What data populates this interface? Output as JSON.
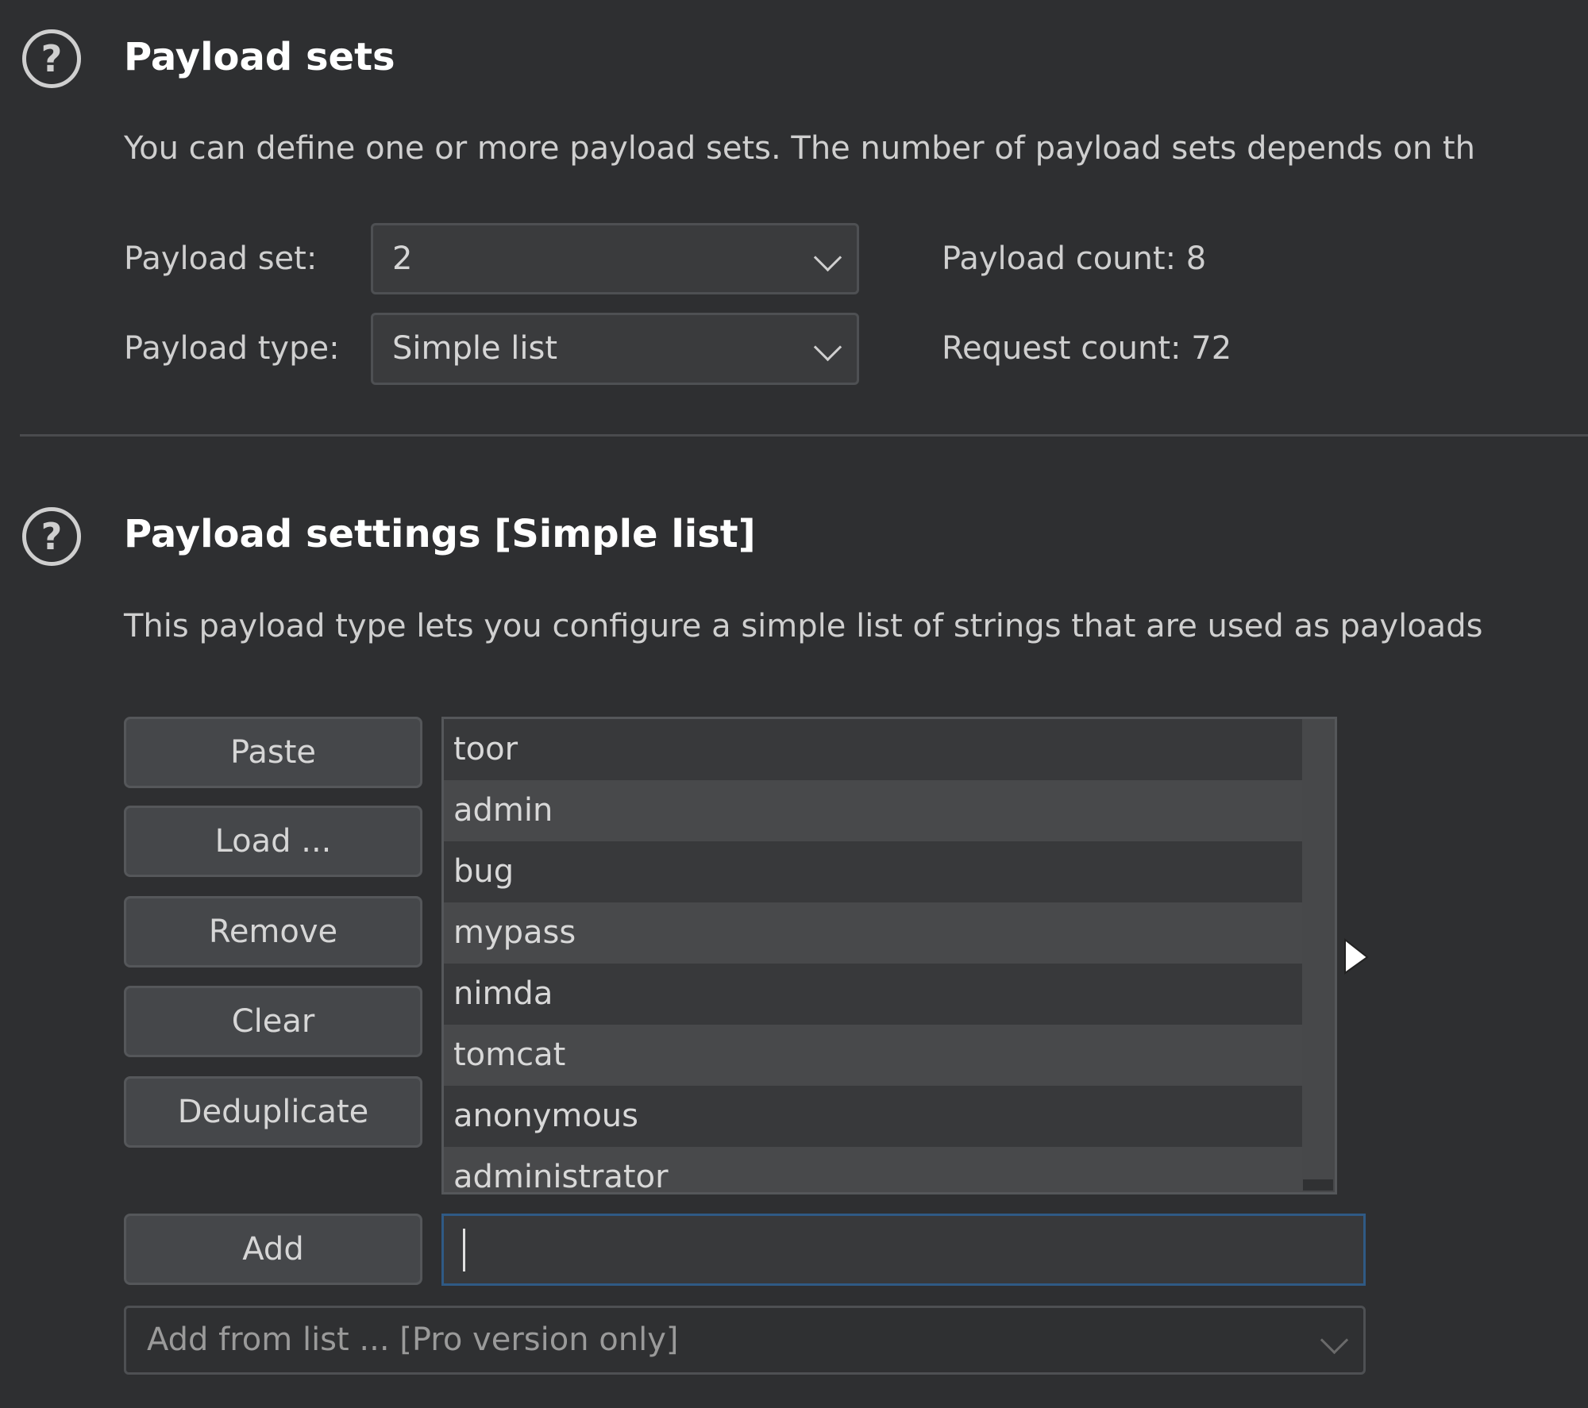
{
  "payload_sets": {
    "title": "Payload sets",
    "description": "You can define one or more payload sets. The number of payload sets depends on th",
    "payload_set_label": "Payload set:",
    "payload_set_value": "2",
    "payload_type_label": "Payload type:",
    "payload_type_value": "Simple list",
    "payload_count": "Payload count: 8",
    "request_count": "Request count: 72"
  },
  "payload_settings": {
    "title": "Payload settings [Simple list]",
    "description": "This payload type lets you configure a simple list of strings that are used as payloads",
    "buttons": {
      "paste": "Paste",
      "load": "Load ...",
      "remove": "Remove",
      "clear": "Clear",
      "deduplicate": "Deduplicate",
      "add": "Add"
    },
    "items": [
      "toor",
      "admin",
      "bug",
      "mypass",
      "nimda",
      "tomcat",
      "anonymous",
      "administrator"
    ],
    "add_input_value": "",
    "add_from_list": "Add from list ... [Pro version only]"
  },
  "colors": {
    "background": "#2e2f31",
    "focus_border": "#2f5a85"
  }
}
